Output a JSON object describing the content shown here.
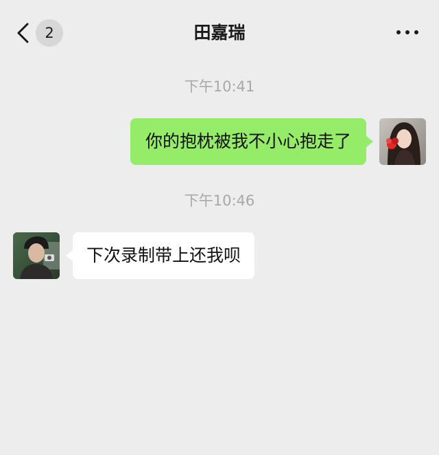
{
  "header": {
    "back_label": "back",
    "unread_count": "2",
    "title": "田嘉瑞",
    "more_icon": "more-dots-icon"
  },
  "messages": [
    {
      "timestamp": "下午10:41",
      "direction": "sent",
      "text": "你的抱枕被我不小心抱走了"
    },
    {
      "timestamp": "下午10:46",
      "direction": "received",
      "text": "下次录制带上还我呗"
    }
  ],
  "colors": {
    "background": "#ededed",
    "sent_bubble": "#95ec69",
    "received_bubble": "#ffffff",
    "timestamp_text": "#a8a8a8"
  }
}
